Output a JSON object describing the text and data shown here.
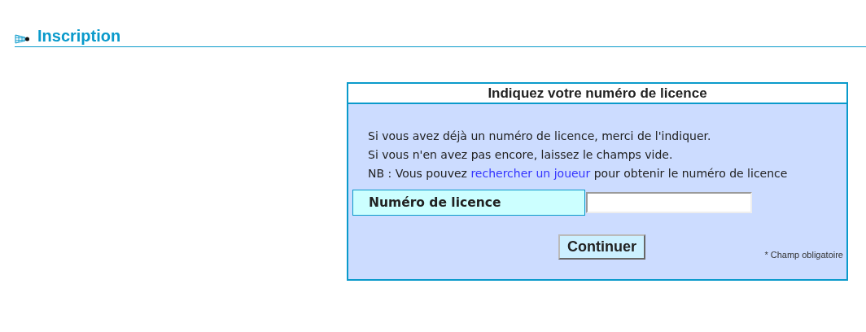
{
  "section": {
    "title": "Inscription"
  },
  "form": {
    "title": "Indiquez votre numéro de licence",
    "lines": [
      "Si vous avez déjà un numéro de licence, merci de l'indiquer.",
      "Si vous n'en avez pas encore, laissez le champs vide."
    ],
    "nb": {
      "before": "NB : Vous pouvez",
      "link": "rechercher un joueur",
      "after": "pour obtenir le numéro de licence"
    },
    "field": {
      "label": "Numéro de licence"
    },
    "button": "Continuer",
    "required_note": "* Champ obligatoire"
  }
}
